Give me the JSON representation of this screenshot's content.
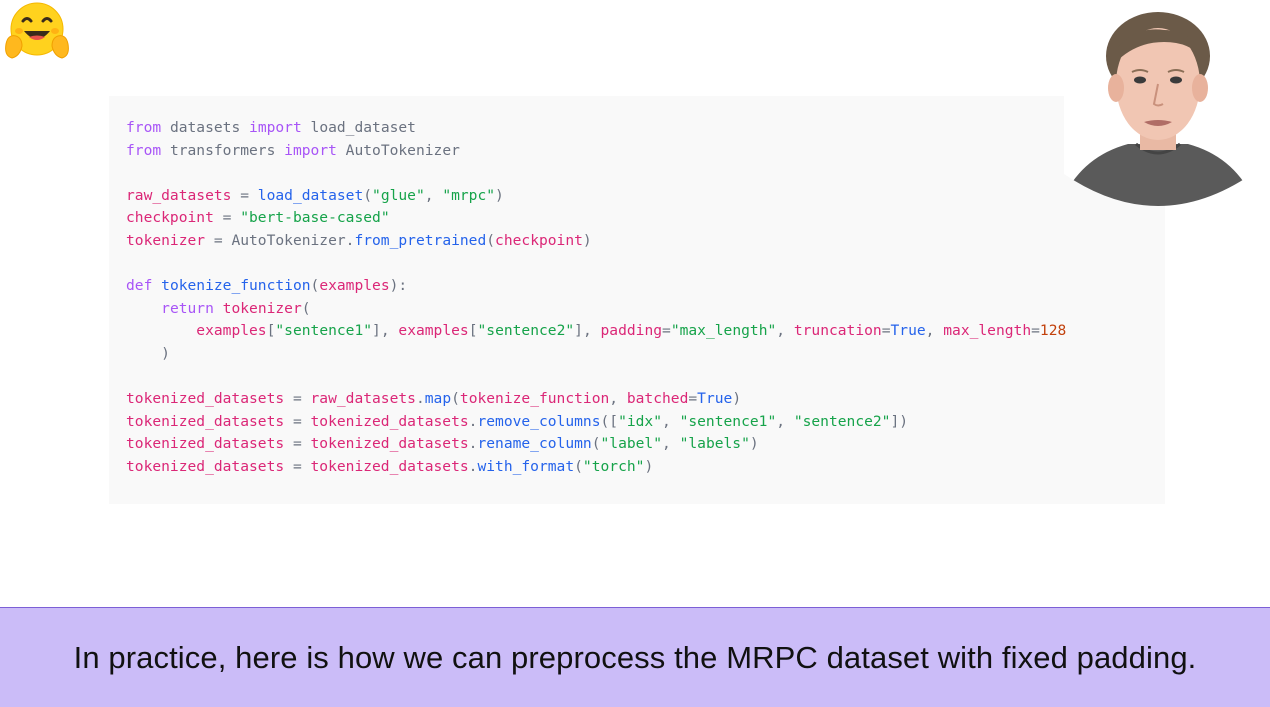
{
  "logo": {
    "icon": "hugging-face-icon"
  },
  "code": {
    "lines": [
      [
        [
          "kw",
          "from"
        ],
        [
          "pl",
          " datasets "
        ],
        [
          "kw",
          "import"
        ],
        [
          "pl",
          " load_dataset"
        ]
      ],
      [
        [
          "kw",
          "from"
        ],
        [
          "pl",
          " transformers "
        ],
        [
          "kw",
          "import"
        ],
        [
          "pl",
          " AutoTokenizer"
        ]
      ],
      [],
      [
        [
          "var",
          "raw_datasets"
        ],
        [
          "pl",
          " = "
        ],
        [
          "fn",
          "load_dataset"
        ],
        [
          "pl",
          "("
        ],
        [
          "str",
          "\"glue\""
        ],
        [
          "pl",
          ", "
        ],
        [
          "str",
          "\"mrpc\""
        ],
        [
          "pl",
          ")"
        ]
      ],
      [
        [
          "var",
          "checkpoint"
        ],
        [
          "pl",
          " = "
        ],
        [
          "str",
          "\"bert-base-cased\""
        ]
      ],
      [
        [
          "var",
          "tokenizer"
        ],
        [
          "pl",
          " = "
        ],
        [
          "pl",
          "AutoTokenizer."
        ],
        [
          "fn",
          "from_pretrained"
        ],
        [
          "pl",
          "("
        ],
        [
          "var",
          "checkpoint"
        ],
        [
          "pl",
          ")"
        ]
      ],
      [],
      [
        [
          "kw",
          "def"
        ],
        [
          "pl",
          " "
        ],
        [
          "fn",
          "tokenize_function"
        ],
        [
          "pl",
          "("
        ],
        [
          "var",
          "examples"
        ],
        [
          "pl",
          "):"
        ]
      ],
      [
        [
          "pl",
          "    "
        ],
        [
          "kw",
          "return"
        ],
        [
          "pl",
          " "
        ],
        [
          "var",
          "tokenizer"
        ],
        [
          "pl",
          "("
        ]
      ],
      [
        [
          "pl",
          "        "
        ],
        [
          "var",
          "examples"
        ],
        [
          "pl",
          "["
        ],
        [
          "str",
          "\"sentence1\""
        ],
        [
          "pl",
          "], "
        ],
        [
          "var",
          "examples"
        ],
        [
          "pl",
          "["
        ],
        [
          "str",
          "\"sentence2\""
        ],
        [
          "pl",
          "], "
        ],
        [
          "var",
          "padding"
        ],
        [
          "pl",
          "="
        ],
        [
          "str",
          "\"max_length\""
        ],
        [
          "pl",
          ", "
        ],
        [
          "var",
          "truncation"
        ],
        [
          "pl",
          "="
        ],
        [
          "fn",
          "True"
        ],
        [
          "pl",
          ", "
        ],
        [
          "var",
          "max_length"
        ],
        [
          "pl",
          "="
        ],
        [
          "num",
          "128"
        ]
      ],
      [
        [
          "pl",
          "    )"
        ]
      ],
      [],
      [
        [
          "var",
          "tokenized_datasets"
        ],
        [
          "pl",
          " = "
        ],
        [
          "var",
          "raw_datasets"
        ],
        [
          "pl",
          "."
        ],
        [
          "fn",
          "map"
        ],
        [
          "pl",
          "("
        ],
        [
          "var",
          "tokenize_function"
        ],
        [
          "pl",
          ", "
        ],
        [
          "var",
          "batched"
        ],
        [
          "pl",
          "="
        ],
        [
          "fn",
          "True"
        ],
        [
          "pl",
          ")"
        ]
      ],
      [
        [
          "var",
          "tokenized_datasets"
        ],
        [
          "pl",
          " = "
        ],
        [
          "var",
          "tokenized_datasets"
        ],
        [
          "pl",
          "."
        ],
        [
          "fn",
          "remove_columns"
        ],
        [
          "pl",
          "(["
        ],
        [
          "str",
          "\"idx\""
        ],
        [
          "pl",
          ", "
        ],
        [
          "str",
          "\"sentence1\""
        ],
        [
          "pl",
          ", "
        ],
        [
          "str",
          "\"sentence2\""
        ],
        [
          "pl",
          "])"
        ]
      ],
      [
        [
          "var",
          "tokenized_datasets"
        ],
        [
          "pl",
          " = "
        ],
        [
          "var",
          "tokenized_datasets"
        ],
        [
          "pl",
          "."
        ],
        [
          "fn",
          "rename_column"
        ],
        [
          "pl",
          "("
        ],
        [
          "str",
          "\"label\""
        ],
        [
          "pl",
          ", "
        ],
        [
          "str",
          "\"labels\""
        ],
        [
          "pl",
          ")"
        ]
      ],
      [
        [
          "var",
          "tokenized_datasets"
        ],
        [
          "pl",
          " = "
        ],
        [
          "var",
          "tokenized_datasets"
        ],
        [
          "pl",
          "."
        ],
        [
          "fn",
          "with_format"
        ],
        [
          "pl",
          "("
        ],
        [
          "str",
          "\"torch\""
        ],
        [
          "pl",
          ")"
        ]
      ]
    ]
  },
  "presenter": {
    "icon": "presenter-webcam"
  },
  "subtitle": {
    "text": "In practice, here is how we can preprocess the MRPC dataset with fixed padding."
  },
  "colors": {
    "keyword": "#a855f7",
    "string": "#16a34a",
    "function": "#2563eb",
    "variable": "#db2777",
    "number": "#c2410c",
    "subtitle_bg": "#cbbcf8"
  }
}
